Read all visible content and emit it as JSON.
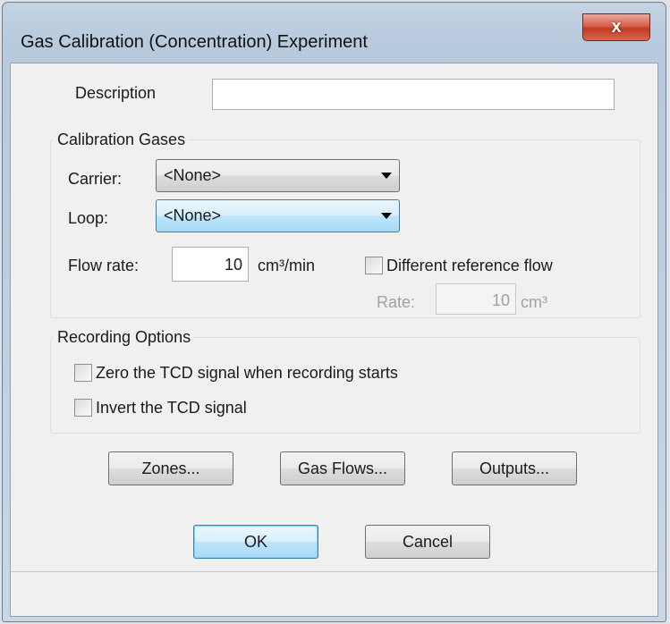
{
  "window": {
    "title": "Gas Calibration (Concentration) Experiment",
    "close_glyph": "x"
  },
  "description": {
    "label": "Description",
    "value": ""
  },
  "calibration_gases": {
    "title": "Calibration Gases",
    "carrier_label": "Carrier:",
    "carrier_value": "<None>",
    "loop_label": "Loop:",
    "loop_value": "<None>",
    "flow_rate_label": "Flow rate:",
    "flow_rate_value": "10",
    "flow_rate_unit": "cm³/min",
    "different_reference_label": "Different reference flow",
    "different_reference_checked": false,
    "rate_label": "Rate:",
    "rate_value": "10",
    "rate_unit": "cm³"
  },
  "recording_options": {
    "title": "Recording Options",
    "zero_tcd_label": "Zero the TCD signal when recording starts",
    "zero_tcd_checked": false,
    "invert_tcd_label": "Invert the TCD signal",
    "invert_tcd_checked": false
  },
  "buttons": {
    "zones": "Zones...",
    "gas_flows": "Gas Flows...",
    "outputs": "Outputs...",
    "ok": "OK",
    "cancel": "Cancel"
  },
  "colors": {
    "close_button": "#c13b22",
    "default_button_border": "#3c7fb1",
    "dialog_background": "#f0f0f0"
  }
}
